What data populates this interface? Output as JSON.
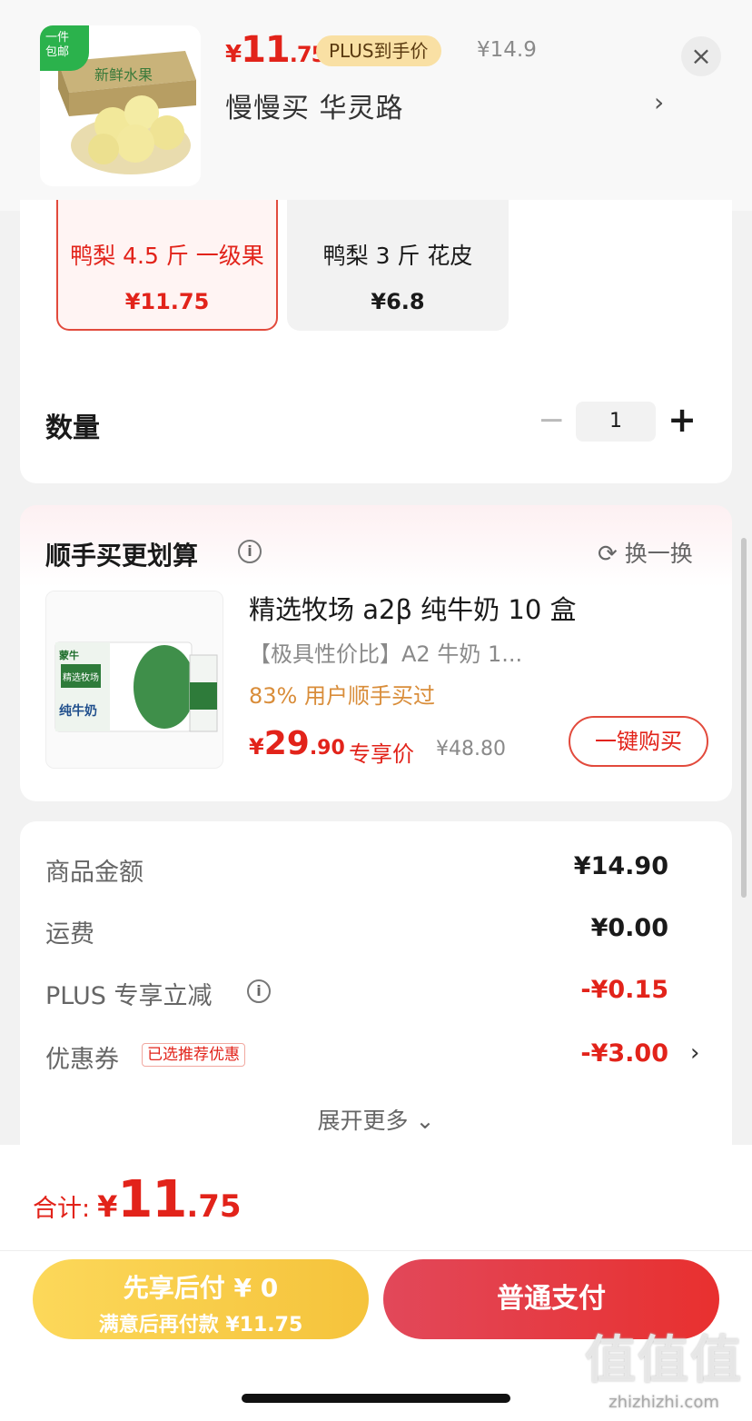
{
  "header": {
    "badge_line1": "一件",
    "badge_line2": "包邮",
    "price_symbol": "¥",
    "price_int": "11",
    "price_dec": ".75",
    "plus_tag": "PLUS到手价",
    "original_price": "¥14.9",
    "store_name": "慢慢买  华灵路",
    "store_arrow": "›",
    "close": "×"
  },
  "variants": [
    {
      "name": "鸭梨 4.5 斤 一级果",
      "price": "¥11.75",
      "selected": true
    },
    {
      "name": "鸭梨 3 斤 花皮",
      "price": "¥6.8",
      "selected": false
    }
  ],
  "quantity": {
    "label": "数量",
    "minus": "−",
    "value": "1",
    "plus": "+"
  },
  "bundle": {
    "title": "顺手买更划算",
    "info": "i",
    "swap_icon": "⟳",
    "swap_label": "换一换",
    "product": {
      "name": "精选牧场 a2β 纯牛奶 10 盒",
      "desc": "【极具性价比】A2 牛奶 1...",
      "bought": "83% 用户顺手买过",
      "price_symbol": "¥",
      "price_int": "29",
      "price_dec": ".90",
      "price_tag": "专享价",
      "original_price": "¥48.80",
      "buy_button": "一键购买",
      "image_brand": "蒙牛",
      "image_text": "精选牧场",
      "image_sub": "纯牛奶"
    }
  },
  "summary": {
    "rows": [
      {
        "label": "商品金额",
        "value": "¥14.90"
      },
      {
        "label": "运费",
        "value": "¥0.00"
      },
      {
        "label": "PLUS 专享立减",
        "value": "-¥0.15"
      },
      {
        "label": "优惠券",
        "value": "-¥3.00"
      }
    ],
    "coupon_tag": "已选推荐优惠",
    "coupon_arrow": "›",
    "expand": "展开更多 ⌄"
  },
  "footer": {
    "total_label": "合计:",
    "total_symbol": "¥",
    "total_int": "11",
    "total_dec": ".75",
    "later_line1": "先享后付 ¥ 0",
    "later_line2": "满意后再付款 ¥11.75",
    "pay_button": "普通支付"
  },
  "watermark": {
    "line1": "值值值",
    "line2": "zhizhizhi.com"
  },
  "colors": {
    "accent_red": "#e2231a",
    "plus_gold": "#f9e0a4",
    "later_yellow": "#f5c33b",
    "bought_orange": "#d98d3a"
  }
}
